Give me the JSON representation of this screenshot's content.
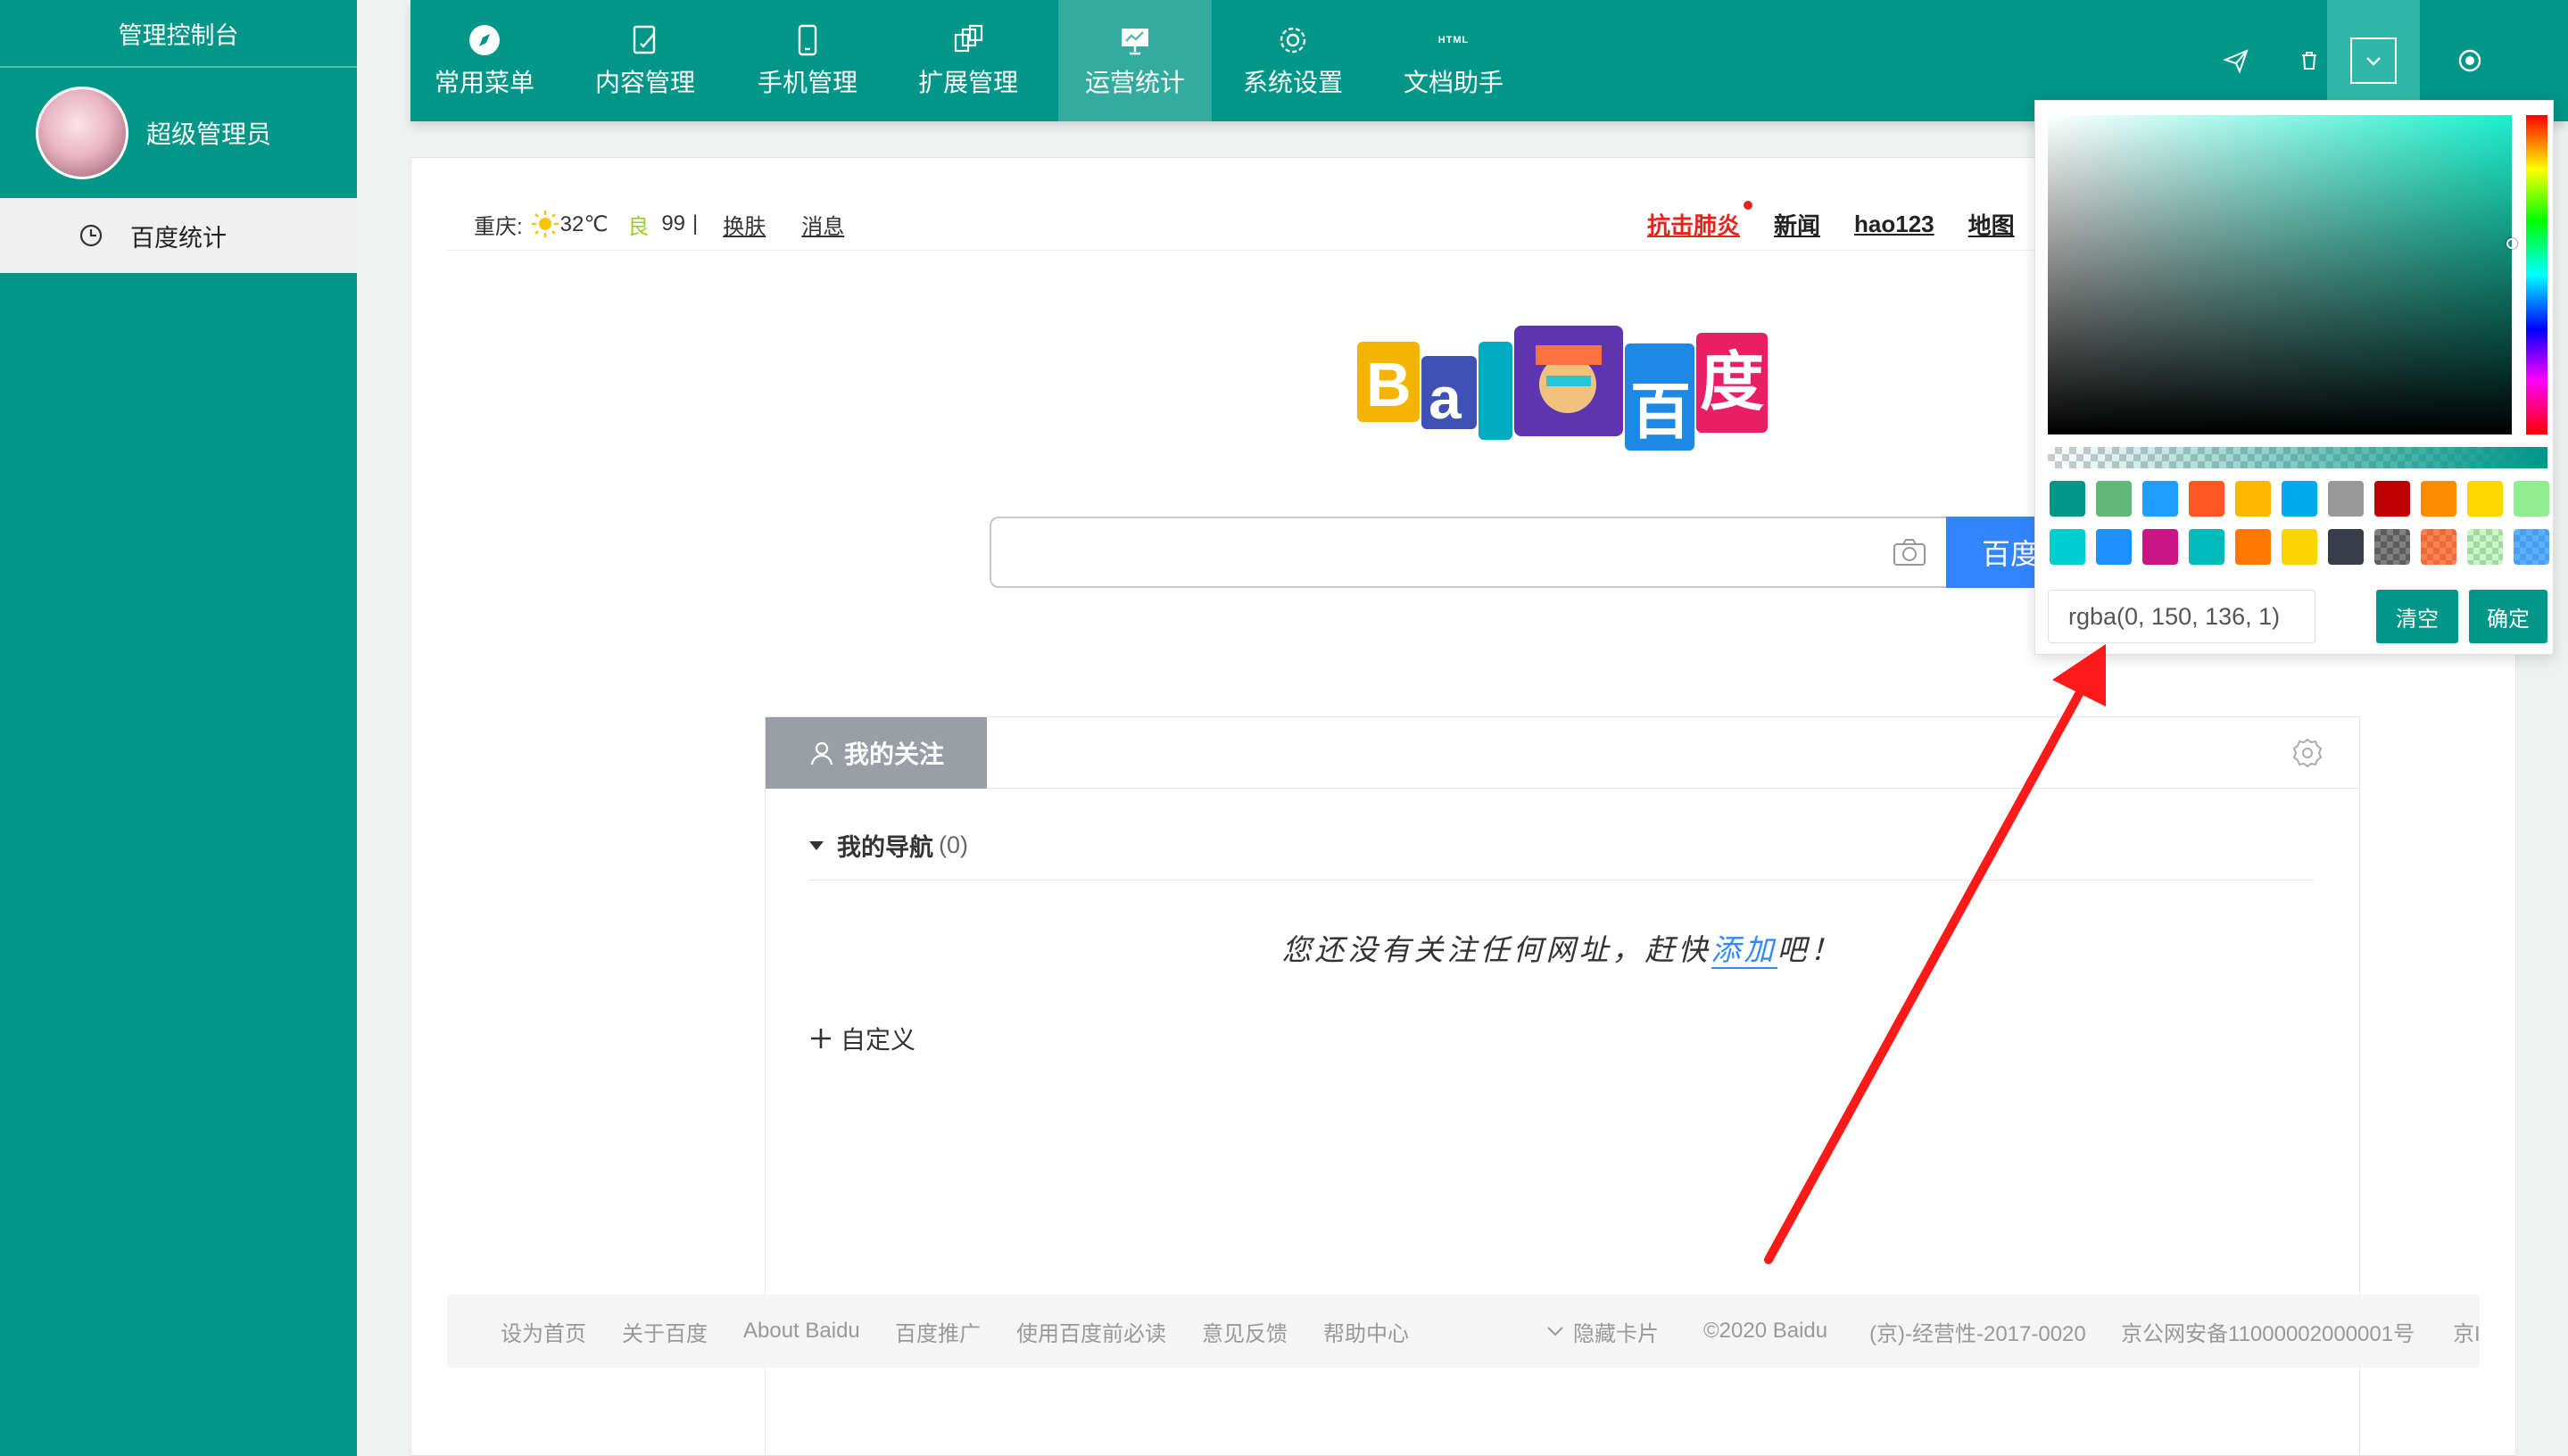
{
  "sidebar": {
    "title": "管理控制台",
    "user_name": "超级管理员",
    "menu_item": "百度统计"
  },
  "topnav": {
    "items": [
      {
        "label": "常用菜单",
        "icon": "compass-icon"
      },
      {
        "label": "内容管理",
        "icon": "edit-doc-icon"
      },
      {
        "label": "手机管理",
        "icon": "phone-icon"
      },
      {
        "label": "扩展管理",
        "icon": "extension-icon"
      },
      {
        "label": "运营统计",
        "icon": "stats-board-icon"
      },
      {
        "label": "系统设置",
        "icon": "gear-icon"
      },
      {
        "label": "文档助手",
        "icon": "html-icon"
      }
    ],
    "html_badge": "HTML",
    "active_index": 4
  },
  "baidu": {
    "city": "重庆:",
    "temp": "32℃",
    "air_label": "良",
    "air_value": "99",
    "sep": "|",
    "skin": "换肤",
    "msg": "消息",
    "links": [
      "抗击肺炎",
      "新闻",
      "hao123",
      "地图"
    ],
    "search_btn": "百度",
    "follow_tab": "我的关注",
    "nav_title": "我的导航",
    "nav_count": "(0)",
    "empty_pre": "您还没有关注任何网址，赶快",
    "empty_add": "添加",
    "empty_post": "吧！",
    "custom": "自定义",
    "footer": [
      "设为首页",
      "关于百度",
      "About Baidu",
      "百度推广",
      "使用百度前必读",
      "意见反馈",
      "帮助中心",
      "隐藏卡片",
      "©2020 Baidu",
      "(京)-经营性-2017-0020",
      "京公网安备11000002000001号",
      "京I"
    ]
  },
  "picker": {
    "value": "rgba(0, 150, 136, 1)",
    "clear_label": "清空",
    "confirm_label": "确定",
    "swatches": [
      "#009688",
      "#5fb878",
      "#1e9fff",
      "#ff5722",
      "#ffb800",
      "#01aaed",
      "#999999",
      "#c00000",
      "#ff8c00",
      "#ffd700",
      "#90ee90",
      "#00ced1",
      "#1e90ff",
      "#c71585",
      "#00babd",
      "#ff7800",
      "#fad400",
      "#393d49",
      "rgba(0,0,0,0.5)",
      "rgba(255,69,0,0.68)",
      "rgba(144,240,144,0.5)",
      "rgba(31,147,255,0.73)"
    ],
    "hue_color": "#1df0cd"
  },
  "colors": {
    "primary": "#009688",
    "arrow": "#ff1a1a"
  }
}
